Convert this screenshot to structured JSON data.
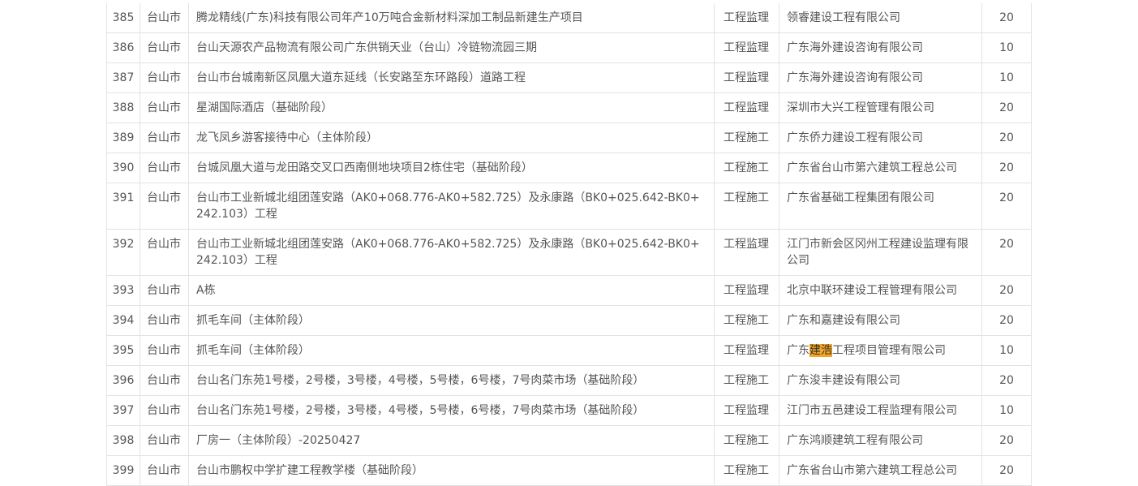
{
  "table": {
    "rows": [
      {
        "no": "385",
        "city": "台山市",
        "project": "腾龙精线(广东)科技有限公司年产10万吨合金新材料深加工制品新建生产项目",
        "type": "工程监理",
        "company": "领睿建设工程有限公司",
        "score": "20"
      },
      {
        "no": "386",
        "city": "台山市",
        "project": "台山天源农产品物流有限公司广东供销天业（台山）冷链物流园三期",
        "type": "工程监理",
        "company": "广东海外建设咨询有限公司",
        "score": "10"
      },
      {
        "no": "387",
        "city": "台山市",
        "project": "台山市台城南新区凤凰大道东延线（长安路至东环路段）道路工程",
        "type": "工程监理",
        "company": "广东海外建设咨询有限公司",
        "score": "10"
      },
      {
        "no": "388",
        "city": "台山市",
        "project": "星湖国际酒店（基础阶段）",
        "type": "工程监理",
        "company": "深圳市大兴工程管理有限公司",
        "score": "20"
      },
      {
        "no": "389",
        "city": "台山市",
        "project": "龙飞凤乡游客接待中心（主体阶段）",
        "type": "工程施工",
        "company": "广东侨力建设工程有限公司",
        "score": "20"
      },
      {
        "no": "390",
        "city": "台山市",
        "project": "台城凤凰大道与龙田路交叉口西南侧地块项目2栋住宅（基础阶段）",
        "type": "工程施工",
        "company": "广东省台山市第六建筑工程总公司",
        "score": "20"
      },
      {
        "no": "391",
        "city": "台山市",
        "project": "台山市工业新城北组团莲安路（AK0+068.776-AK0+582.725）及永康路（BK0+025.642-BK0+242.103）工程",
        "type": "工程施工",
        "company": "广东省基础工程集团有限公司",
        "score": "20"
      },
      {
        "no": "392",
        "city": "台山市",
        "project": "台山市工业新城北组团莲安路（AK0+068.776-AK0+582.725）及永康路（BK0+025.642-BK0+242.103）工程",
        "type": "工程监理",
        "company": "江门市新会区冈州工程建设监理有限公司",
        "score": "20"
      },
      {
        "no": "393",
        "city": "台山市",
        "project": "A栋",
        "type": "工程监理",
        "company": "北京中联环建设工程管理有限公司",
        "score": "20"
      },
      {
        "no": "394",
        "city": "台山市",
        "project": "抓毛车间（主体阶段）",
        "type": "工程施工",
        "company": "广东和嘉建设有限公司",
        "score": "20"
      },
      {
        "no": "395",
        "city": "台山市",
        "project": "抓毛车间（主体阶段）",
        "type": "工程监理",
        "company_pre": "广东",
        "company_hl": "建浩",
        "company_post": "工程项目管理有限公司",
        "score": "10"
      },
      {
        "no": "396",
        "city": "台山市",
        "project": "台山名门东苑1号楼，2号楼，3号楼，4号楼，5号楼，6号楼，7号肉菜市场（基础阶段）",
        "type": "工程施工",
        "company": "广东浚丰建设有限公司",
        "score": "20"
      },
      {
        "no": "397",
        "city": "台山市",
        "project": "台山名门东苑1号楼，2号楼，3号楼，4号楼，5号楼，6号楼，7号肉菜市场（基础阶段）",
        "type": "工程监理",
        "company": "江门市五邑建设工程监理有限公司",
        "score": "10"
      },
      {
        "no": "398",
        "city": "台山市",
        "project": "厂房一（主体阶段）-20250427",
        "type": "工程施工",
        "company": "广东鸿顺建筑工程有限公司",
        "score": "20"
      },
      {
        "no": "399",
        "city": "台山市",
        "project": "台山市鹏权中学扩建工程教学楼（基础阶段）",
        "type": "工程施工",
        "company": "广东省台山市第六建筑工程总公司",
        "score": "20"
      }
    ]
  },
  "colors": {
    "border": "#e3e3e3",
    "text": "#555555",
    "highlight": "#f5a623"
  }
}
